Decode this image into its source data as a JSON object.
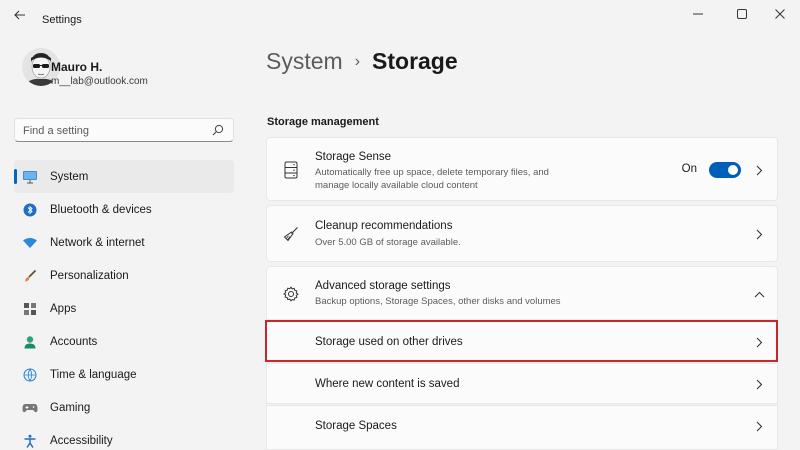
{
  "window": {
    "title": "Settings"
  },
  "profile": {
    "name": "Mauro H.",
    "email": "m__lab@outlook.com"
  },
  "search": {
    "placeholder": "Find a setting"
  },
  "nav": {
    "items": [
      {
        "label": "System",
        "icon": "monitor-icon",
        "selected": true
      },
      {
        "label": "Bluetooth & devices",
        "icon": "bluetooth-icon"
      },
      {
        "label": "Network & internet",
        "icon": "wifi-icon"
      },
      {
        "label": "Personalization",
        "icon": "brush-icon"
      },
      {
        "label": "Apps",
        "icon": "apps-icon"
      },
      {
        "label": "Accounts",
        "icon": "person-icon"
      },
      {
        "label": "Time & language",
        "icon": "globe-clock-icon"
      },
      {
        "label": "Gaming",
        "icon": "gamepad-icon"
      },
      {
        "label": "Accessibility",
        "icon": "accessibility-icon"
      }
    ]
  },
  "breadcrumb": {
    "parent": "System",
    "separator": "›",
    "current": "Storage"
  },
  "section": {
    "title": "Storage management"
  },
  "storage_sense": {
    "title": "Storage Sense",
    "description_line1": "Automatically free up space, delete temporary files, and",
    "description_line2": "manage locally available cloud content",
    "toggle_label": "On",
    "toggle_on": true
  },
  "cleanup": {
    "title": "Cleanup recommendations",
    "description": "Over 5.00 GB of storage available."
  },
  "advanced": {
    "title": "Advanced storage settings",
    "description": "Backup options, Storage Spaces, other disks and volumes",
    "expanded": true,
    "sub_items": [
      {
        "label": "Storage used on other drives",
        "highlighted": true
      },
      {
        "label": "Where new content is saved"
      },
      {
        "label": "Storage Spaces"
      }
    ]
  },
  "colors": {
    "accent": "#005fb8",
    "highlight_border": "#c4282e",
    "background": "#f3f3f3",
    "card": "#fbfbfb"
  }
}
